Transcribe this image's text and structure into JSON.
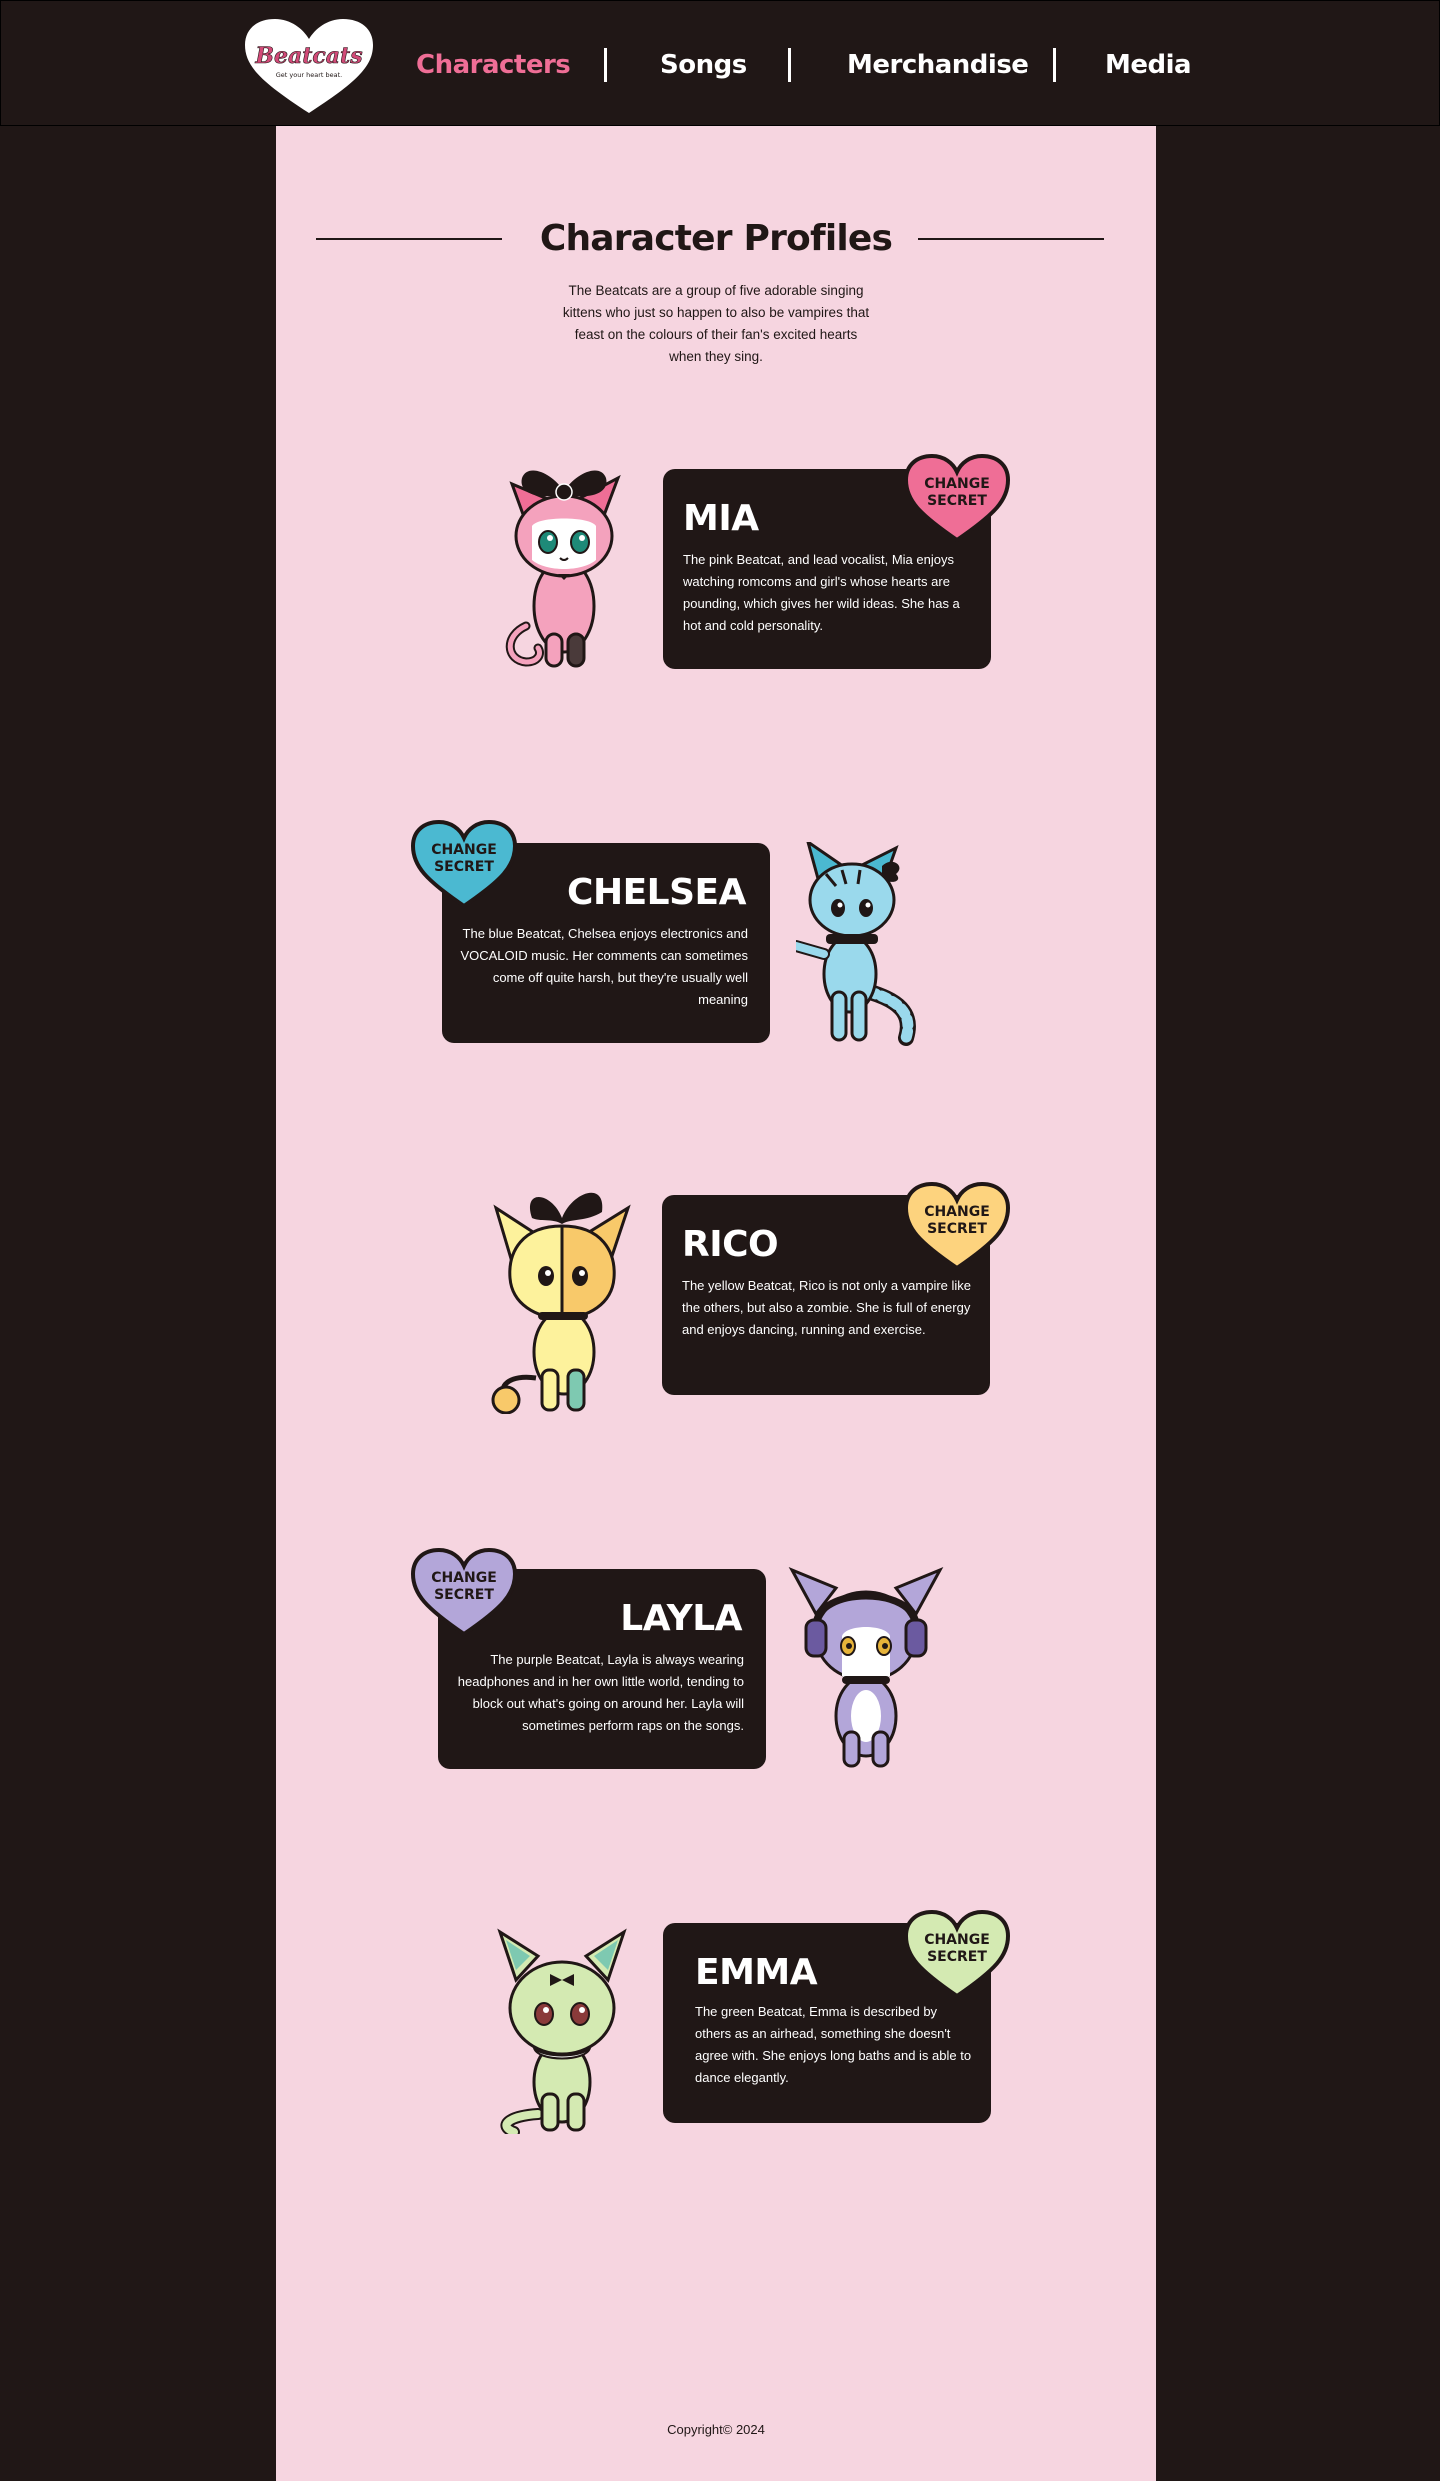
{
  "header": {
    "logo_text": "Beatcats",
    "logo_tagline": "Get your heart beat.",
    "nav": [
      {
        "label": "Characters",
        "active": true
      },
      {
        "label": "Songs",
        "active": false
      },
      {
        "label": "Merchandise",
        "active": false
      },
      {
        "label": "Media",
        "active": false
      }
    ]
  },
  "main": {
    "title": "Character Profiles",
    "intro": "The Beatcats are a group of five adorable singing kittens who just so happen to also be vampires that feast on the colours of their fan's excited hearts when they sing."
  },
  "characters": [
    {
      "name": "MIA",
      "color": "#ef6e96",
      "button_label": "CHANGE SECRET",
      "description": "The pink Beatcat, and lead vocalist, Mia enjoys watching romcoms and girl's whose hearts are pounding, which gives her wild ideas. She has a hot and cold personality."
    },
    {
      "name": "CHELSEA",
      "color": "#4bb9d1",
      "button_label": "CHANGE SECRET",
      "description": "The blue Beatcat, Chelsea enjoys electronics and VOCALOID music. Her comments can sometimes come off quite harsh, but they're usually well meaning"
    },
    {
      "name": "RICO",
      "color": "#fdd37e",
      "button_label": "CHANGE SECRET",
      "description": "The yellow Beatcat, Rico is not only a vampire like the others, but also a zombie. She is full of energy and enjoys dancing, running and exercise."
    },
    {
      "name": "LAYLA",
      "color": "#b3a6d9",
      "button_label": "CHANGE SECRET",
      "description": "The purple Beatcat, Layla is always wearing headphones and in her own little world, tending to block out what's going on around her. Layla will sometimes perform raps on the songs."
    },
    {
      "name": "EMMA",
      "color": "#d4eab2",
      "button_label": "CHANGE SECRET",
      "description": "The green Beatcat, Emma is described by others as an airhead, something she doesn't agree with. She enjoys long baths and is able to dance elegantly."
    }
  ],
  "footer": {
    "copyright": "Copyright© 2024"
  },
  "colors": {
    "page_bg": "#201716",
    "panel_bg": "#f6d5e0",
    "accent": "#ef6e96",
    "card_bg": "#201716"
  }
}
